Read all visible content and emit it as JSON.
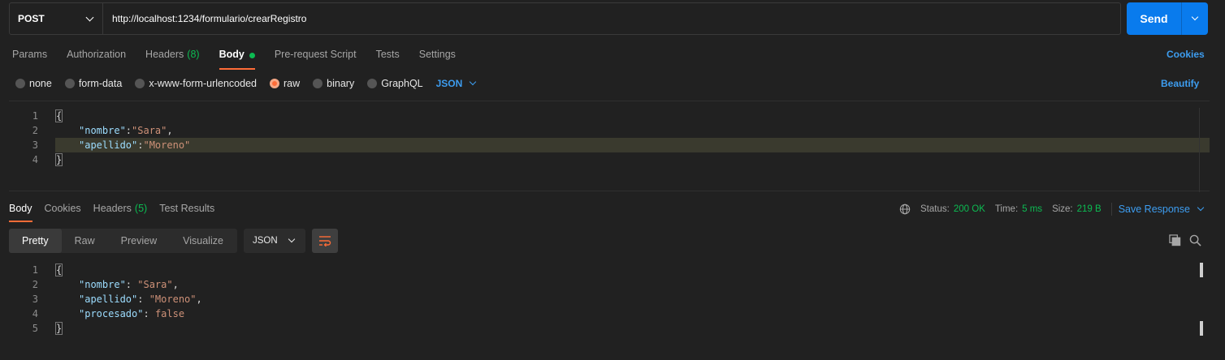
{
  "request": {
    "method": "POST",
    "url": "http://localhost:1234/formulario/crearRegistro",
    "send_label": "Send"
  },
  "req_tabs": {
    "params": "Params",
    "authorization": "Authorization",
    "headers": "Headers",
    "headers_count": "(8)",
    "body": "Body",
    "prerequest": "Pre-request Script",
    "tests": "Tests",
    "settings": "Settings",
    "cookies": "Cookies"
  },
  "body_options": {
    "none": "none",
    "form_data": "form-data",
    "urlencoded": "x-www-form-urlencoded",
    "raw": "raw",
    "binary": "binary",
    "graphql": "GraphQL",
    "format": "JSON",
    "beautify": "Beautify",
    "selected": "raw"
  },
  "request_body": {
    "line_numbers": [
      "1",
      "2",
      "3",
      "4"
    ],
    "open_brace": "{",
    "close_brace": "}",
    "line2_key": "\"nombre\"",
    "line2_sep": ":",
    "line2_val": "\"Sara\"",
    "line2_end": ",",
    "line3_key": "\"apellido\"",
    "line3_sep": ":",
    "line3_val": "\"Moreno\""
  },
  "response": {
    "tabs": {
      "body": "Body",
      "cookies": "Cookies",
      "headers": "Headers",
      "headers_count": "(5)",
      "test_results": "Test Results"
    },
    "status_label": "Status:",
    "status_value": "200 OK",
    "time_label": "Time:",
    "time_value": "5 ms",
    "size_label": "Size:",
    "size_value": "219 B",
    "save_response": "Save Response",
    "views": {
      "pretty": "Pretty",
      "raw": "Raw",
      "preview": "Preview",
      "visualize": "Visualize"
    },
    "format": "JSON",
    "body": {
      "line_numbers": [
        "1",
        "2",
        "3",
        "4",
        "5"
      ],
      "open_brace": "{",
      "close_brace": "}",
      "k1": "\"nombre\"",
      "v1": "\"Sara\"",
      "k2": "\"apellido\"",
      "v2": "\"Moreno\"",
      "k3": "\"procesado\"",
      "v3": "false",
      "colon": ": ",
      "comma": ","
    }
  },
  "colors": {
    "accent": "#ff6c37",
    "link": "#3d9df0",
    "success": "#0cbb52",
    "send": "#097bed"
  }
}
